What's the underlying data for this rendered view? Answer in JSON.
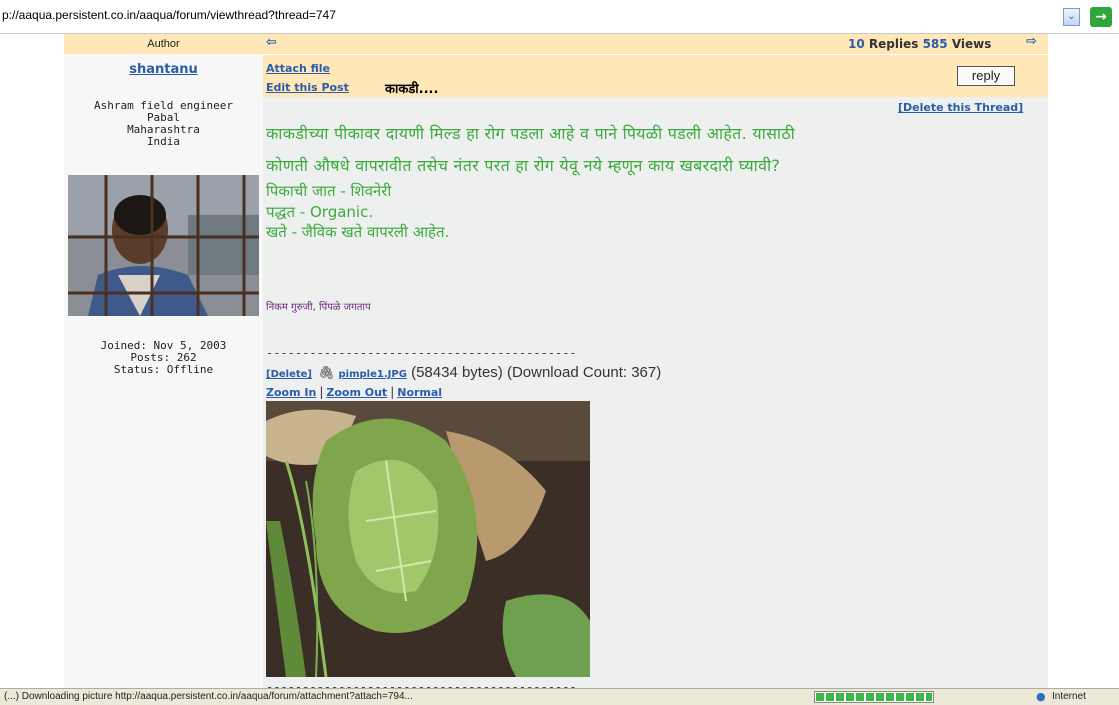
{
  "browser": {
    "url": "p://aaqua.persistent.co.in/aaqua/forum/viewthread?thread=747",
    "dropdown_glyph": "⌄",
    "go_glyph": "→"
  },
  "author_panel": {
    "header": "Author",
    "name": "shantanu",
    "info_lines": [
      "Ashram field engineer",
      "Pabal",
      "Maharashtra",
      "India"
    ],
    "joined": "Joined: Nov 5, 2003",
    "posts": "Posts: 262",
    "status": "Status: Offline"
  },
  "thread_header": {
    "prev_icon": "prev-thread-icon",
    "replies_count": "10",
    "replies_label": "Replies",
    "views_count": "585",
    "views_label": "Views",
    "next_icon": "next-thread-icon"
  },
  "actions": {
    "attach_file": "Attach file",
    "edit_post": "Edit this Post",
    "post_title": "काकडी....",
    "reply": "reply",
    "delete_thread": "[Delete this Thread]"
  },
  "post": {
    "lines": [
      "काकडीच्या पीकावर दायणी मिल्ड हा रोग पडला आहे व पाने पियळी पडली आहेत. यासाठी",
      "कोणती औषधे वापरावीत तसेच नंतर परत हा रोग येवू नये म्हणून काय खबरदारी घ्यावी?",
      "पिकाची जात - शिवनेरी",
      "पद्धत - Organic.",
      "खते - जैविक खते वापरली आहेत."
    ],
    "signature": "निकम गुरुजी, पिंपळे जगताप",
    "color": "#3caa3c"
  },
  "attachment": {
    "separator": "-------------------------------------------",
    "delete_label": "[Delete]",
    "filename": "pimple1.JPG",
    "details": "(58434 bytes) (Download Count: 367)",
    "zoom_in": "Zoom In",
    "zoom_out": "Zoom Out",
    "normal": "Normal",
    "separator_bottom": "-------------------------------------------"
  },
  "statusbar": {
    "text": "(...) Downloading picture http://aaqua.persistent.co.in/aaqua/forum/attachment?attach=794...",
    "zone": "Internet"
  },
  "colors": {
    "link": "#2a5caa",
    "header_bg": "#ffe7b8",
    "post_bg": "#eef0f0"
  }
}
